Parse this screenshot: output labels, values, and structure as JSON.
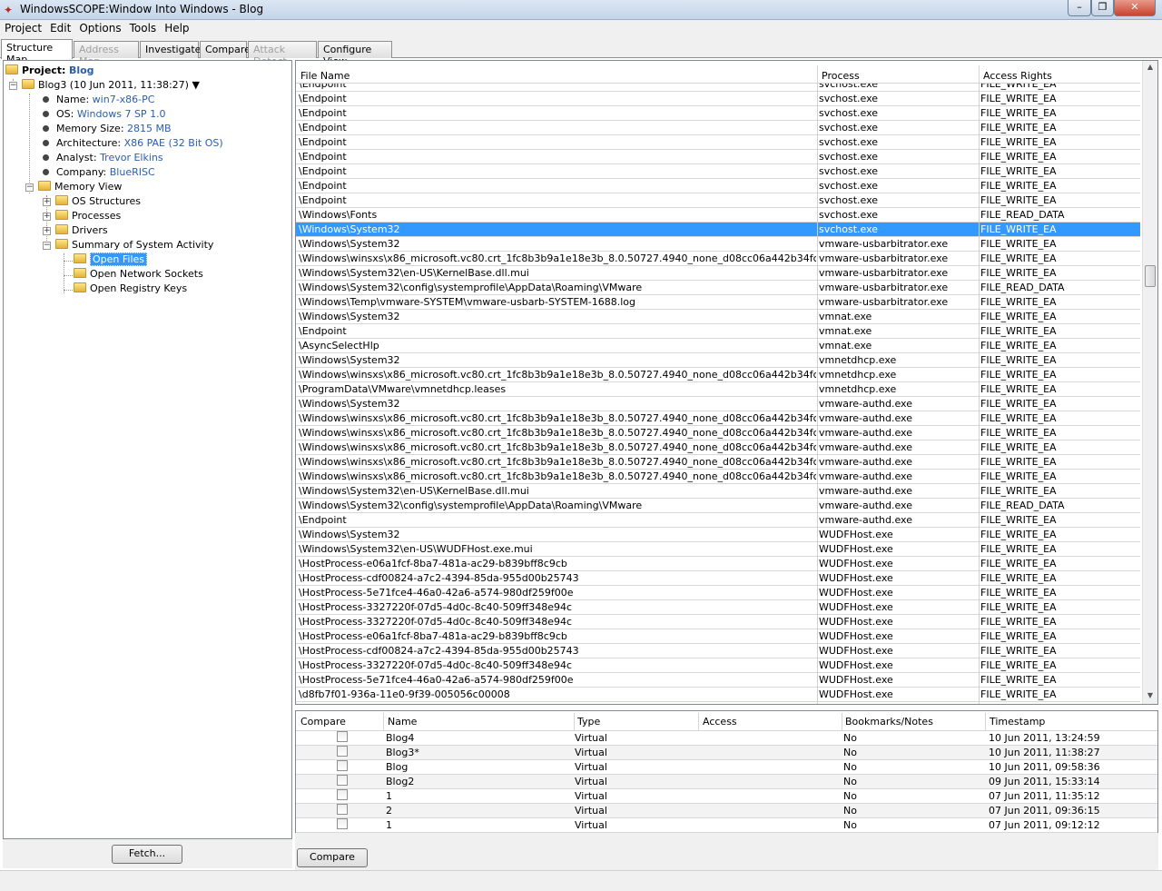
{
  "window": {
    "title": "WindowsSCOPE:Window Into Windows - Blog"
  },
  "menu": [
    "Project",
    "Edit",
    "Options",
    "Tools",
    "Help"
  ],
  "tabs": [
    {
      "label": "Structure Map",
      "state": "active"
    },
    {
      "label": "Address Map",
      "state": "disabled"
    },
    {
      "label": "Investigate",
      "state": "normal"
    },
    {
      "label": "Compare",
      "state": "normal"
    },
    {
      "label": "Attack Detect",
      "state": "disabled"
    },
    {
      "label": "Configure View",
      "state": "normal"
    }
  ],
  "tree": {
    "project_key": "Project:",
    "project_value": "Blog",
    "snapshot": "Blog3 (10 Jun 2011, 11:38:27)",
    "props": [
      {
        "k": "Name:",
        "v": "win7-x86-PC"
      },
      {
        "k": "OS:",
        "v": "Windows 7 SP 1.0"
      },
      {
        "k": "Memory Size:",
        "v": "2815 MB"
      },
      {
        "k": "Architecture:",
        "v": "X86 PAE (32 Bit OS)"
      },
      {
        "k": "Analyst:",
        "v": "Trevor Elkins"
      },
      {
        "k": "Company:",
        "v": "BlueRISC"
      }
    ],
    "memory_view": "Memory View",
    "children": [
      "OS Structures",
      "Processes",
      "Drivers",
      "Summary of System Activity"
    ],
    "activity": [
      "Open Files",
      "Open Network Sockets",
      "Open Registry Keys"
    ]
  },
  "fetch_label": "Fetch...",
  "files": {
    "headers": [
      "File Name",
      "Process",
      "Access Rights"
    ],
    "rows": [
      [
        "\\Endpoint",
        "svchost.exe",
        "FILE_WRITE_EA"
      ],
      [
        "\\Endpoint",
        "svchost.exe",
        "FILE_WRITE_EA"
      ],
      [
        "\\Endpoint",
        "svchost.exe",
        "FILE_WRITE_EA"
      ],
      [
        "\\Endpoint",
        "svchost.exe",
        "FILE_WRITE_EA"
      ],
      [
        "\\Endpoint",
        "svchost.exe",
        "FILE_WRITE_EA"
      ],
      [
        "\\Endpoint",
        "svchost.exe",
        "FILE_WRITE_EA"
      ],
      [
        "\\Endpoint",
        "svchost.exe",
        "FILE_WRITE_EA"
      ],
      [
        "\\Endpoint",
        "svchost.exe",
        "FILE_WRITE_EA"
      ],
      [
        "\\Windows\\Fonts",
        "svchost.exe",
        "FILE_READ_DATA"
      ],
      [
        "\\Windows\\System32",
        "svchost.exe",
        "FILE_WRITE_EA"
      ],
      [
        "\\Windows\\System32",
        "vmware-usbarbitrator.exe",
        "FILE_WRITE_EA"
      ],
      [
        "\\Windows\\winsxs\\x86_microsoft.vc80.crt_1fc8b3b9a1e18e3b_8.0.50727.4940_none_d08cc06a442b34fc",
        "vmware-usbarbitrator.exe",
        "FILE_WRITE_EA"
      ],
      [
        "\\Windows\\System32\\en-US\\KernelBase.dll.mui",
        "vmware-usbarbitrator.exe",
        "FILE_WRITE_EA"
      ],
      [
        "\\Windows\\System32\\config\\systemprofile\\AppData\\Roaming\\VMware",
        "vmware-usbarbitrator.exe",
        "FILE_READ_DATA"
      ],
      [
        "\\Windows\\Temp\\vmware-SYSTEM\\vmware-usbarb-SYSTEM-1688.log",
        "vmware-usbarbitrator.exe",
        "FILE_WRITE_EA"
      ],
      [
        "\\Windows\\System32",
        "vmnat.exe",
        "FILE_WRITE_EA"
      ],
      [
        "\\Endpoint",
        "vmnat.exe",
        "FILE_WRITE_EA"
      ],
      [
        "\\AsyncSelectHlp",
        "vmnat.exe",
        "FILE_WRITE_EA"
      ],
      [
        "\\Windows\\System32",
        "vmnetdhcp.exe",
        "FILE_WRITE_EA"
      ],
      [
        "\\Windows\\winsxs\\x86_microsoft.vc80.crt_1fc8b3b9a1e18e3b_8.0.50727.4940_none_d08cc06a442b34fc",
        "vmnetdhcp.exe",
        "FILE_WRITE_EA"
      ],
      [
        "\\ProgramData\\VMware\\vmnetdhcp.leases",
        "vmnetdhcp.exe",
        "FILE_WRITE_EA"
      ],
      [
        "\\Windows\\System32",
        "vmware-authd.exe",
        "FILE_WRITE_EA"
      ],
      [
        "\\Windows\\winsxs\\x86_microsoft.vc80.crt_1fc8b3b9a1e18e3b_8.0.50727.4940_none_d08cc06a442b34fc",
        "vmware-authd.exe",
        "FILE_WRITE_EA"
      ],
      [
        "\\Windows\\winsxs\\x86_microsoft.vc80.crt_1fc8b3b9a1e18e3b_8.0.50727.4940_none_d08cc06a442b34fc",
        "vmware-authd.exe",
        "FILE_WRITE_EA"
      ],
      [
        "\\Windows\\winsxs\\x86_microsoft.vc80.crt_1fc8b3b9a1e18e3b_8.0.50727.4940_none_d08cc06a442b34fc",
        "vmware-authd.exe",
        "FILE_WRITE_EA"
      ],
      [
        "\\Windows\\winsxs\\x86_microsoft.vc80.crt_1fc8b3b9a1e18e3b_8.0.50727.4940_none_d08cc06a442b34fc",
        "vmware-authd.exe",
        "FILE_WRITE_EA"
      ],
      [
        "\\Windows\\winsxs\\x86_microsoft.vc80.crt_1fc8b3b9a1e18e3b_8.0.50727.4940_none_d08cc06a442b34fc",
        "vmware-authd.exe",
        "FILE_WRITE_EA"
      ],
      [
        "\\Windows\\System32\\en-US\\KernelBase.dll.mui",
        "vmware-authd.exe",
        "FILE_WRITE_EA"
      ],
      [
        "\\Windows\\System32\\config\\systemprofile\\AppData\\Roaming\\VMware",
        "vmware-authd.exe",
        "FILE_READ_DATA"
      ],
      [
        "\\Endpoint",
        "vmware-authd.exe",
        "FILE_WRITE_EA"
      ],
      [
        "\\Windows\\System32",
        "WUDFHost.exe",
        "FILE_WRITE_EA"
      ],
      [
        "\\Windows\\System32\\en-US\\WUDFHost.exe.mui",
        "WUDFHost.exe",
        "FILE_WRITE_EA"
      ],
      [
        "\\HostProcess-e06a1fcf-8ba7-481a-ac29-b839bff8c9cb",
        "WUDFHost.exe",
        "FILE_WRITE_EA"
      ],
      [
        "\\HostProcess-cdf00824-a7c2-4394-85da-955d00b25743",
        "WUDFHost.exe",
        "FILE_WRITE_EA"
      ],
      [
        "\\HostProcess-5e71fce4-46a0-42a6-a574-980df259f00e",
        "WUDFHost.exe",
        "FILE_WRITE_EA"
      ],
      [
        "\\HostProcess-3327220f-07d5-4d0c-8c40-509ff348e94c",
        "WUDFHost.exe",
        "FILE_WRITE_EA"
      ],
      [
        "\\HostProcess-3327220f-07d5-4d0c-8c40-509ff348e94c",
        "WUDFHost.exe",
        "FILE_WRITE_EA"
      ],
      [
        "\\HostProcess-e06a1fcf-8ba7-481a-ac29-b839bff8c9cb",
        "WUDFHost.exe",
        "FILE_WRITE_EA"
      ],
      [
        "\\HostProcess-cdf00824-a7c2-4394-85da-955d00b25743",
        "WUDFHost.exe",
        "FILE_WRITE_EA"
      ],
      [
        "\\HostProcess-3327220f-07d5-4d0c-8c40-509ff348e94c",
        "WUDFHost.exe",
        "FILE_WRITE_EA"
      ],
      [
        "\\HostProcess-5e71fce4-46a0-42a6-a574-980df259f00e",
        "WUDFHost.exe",
        "FILE_WRITE_EA"
      ],
      [
        "\\d8fb7f01-936a-11e0-9f39-005056c00008",
        "WUDFHost.exe",
        "FILE_WRITE_EA"
      ]
    ],
    "selected_row": 9
  },
  "snapshots": {
    "headers": [
      "Compare",
      "Name",
      "Type",
      "Access",
      "Bookmarks/Notes",
      "Timestamp"
    ],
    "rows": [
      [
        "Blog4",
        "Virtual",
        "No",
        "10 Jun 2011, 13:24:59"
      ],
      [
        "Blog3*",
        "Virtual",
        "No",
        "10 Jun 2011, 11:38:27"
      ],
      [
        "Blog",
        "Virtual",
        "No",
        "10 Jun 2011, 09:58:36"
      ],
      [
        "Blog2",
        "Virtual",
        "No",
        "09 Jun 2011, 15:33:14"
      ],
      [
        "1",
        "Virtual",
        "No",
        "07 Jun 2011, 11:35:12"
      ],
      [
        "2",
        "Virtual",
        "No",
        "07 Jun 2011, 09:36:15"
      ],
      [
        "1",
        "Virtual",
        "No",
        "07 Jun 2011, 09:12:12"
      ]
    ]
  },
  "compare_label": "Compare",
  "colors": {
    "selection": "#3399ff",
    "value_link": "#2a5db0"
  }
}
